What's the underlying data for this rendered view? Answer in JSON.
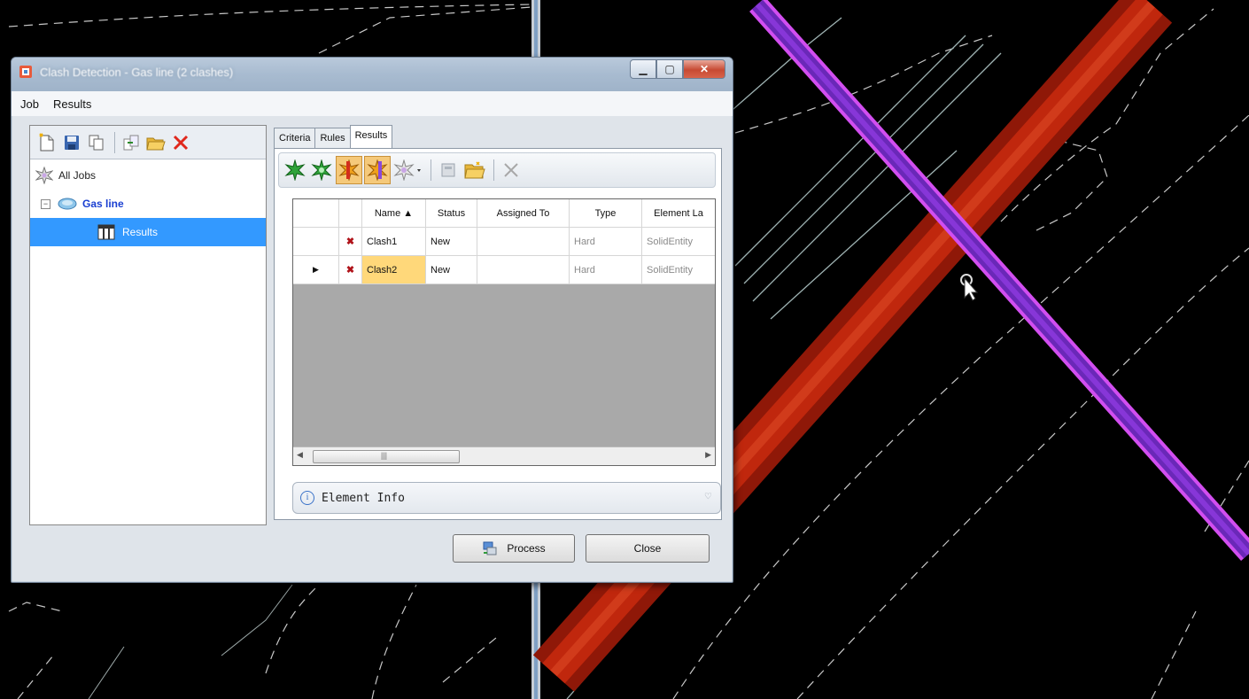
{
  "window": {
    "title": "Clash Detection - Gas line (2 clashes)"
  },
  "menu": [
    "Job",
    "Results"
  ],
  "tree": {
    "all_jobs": "All Jobs",
    "job": "Gas line",
    "results": "Results"
  },
  "tabs": [
    "Criteria",
    "Rules",
    "Results"
  ],
  "grid": {
    "columns": [
      "Name ▲",
      "Status",
      "Assigned To",
      "Type",
      "Element La"
    ],
    "rows": [
      {
        "name": "Clash1",
        "status": "New",
        "assigned": "",
        "type": "Hard",
        "element": "SolidEntity",
        "current": false
      },
      {
        "name": "Clash2",
        "status": "New",
        "assigned": "",
        "type": "Hard",
        "element": "SolidEntity",
        "current": true
      }
    ]
  },
  "element_info": {
    "label": "Element Info"
  },
  "buttons": {
    "process": "Process",
    "close": "Close"
  },
  "colors": {
    "gas_pipe": "#8a2be2",
    "clash_pipe": "#b01e0a",
    "selection": "#3399ff",
    "cell_highlight": "#ffd87a"
  },
  "icons": {
    "left_toolbar": [
      "new-job-icon",
      "save-icon",
      "copy-icon",
      "import-icon",
      "open-folder-icon",
      "delete-icon"
    ],
    "right_toolbar": [
      "show-clash-icon",
      "show-all-clashes-icon",
      "highlight-clash-icon",
      "highlight-element-icon",
      "clash-options-dropdown-icon",
      "properties-icon",
      "open-folder-icon",
      "delete-icon"
    ]
  }
}
